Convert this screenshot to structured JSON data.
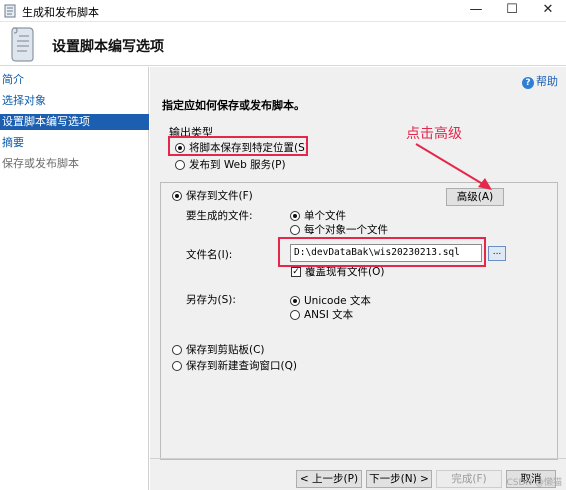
{
  "window": {
    "title": "生成和发布脚本",
    "minimize": "—",
    "maximize": "☐",
    "close": "✕"
  },
  "header": {
    "title": "设置脚本编写选项"
  },
  "sidebar": {
    "items": [
      {
        "label": "简介"
      },
      {
        "label": "选择对象"
      },
      {
        "label": "设置脚本编写选项"
      },
      {
        "label": "摘要"
      },
      {
        "label": "保存或发布脚本"
      }
    ]
  },
  "help": {
    "label": "帮助"
  },
  "main": {
    "instruction": "指定应如何保存或发布脚本。",
    "output_type_label": "输出类型",
    "output_options": [
      {
        "label": "将脚本保存到特定位置(S)",
        "selected": true
      },
      {
        "label": "发布到 Web 服务(P)",
        "selected": false
      }
    ],
    "save_to_file": {
      "label": "保存到文件(F)",
      "selected": true
    },
    "advanced_button": "高级(A)",
    "files_to_generate_label": "要生成的文件:",
    "file_options": [
      {
        "label": "单个文件",
        "selected": true
      },
      {
        "label": "每个对象一个文件",
        "selected": false
      }
    ],
    "filename_label": "文件名(I):",
    "filename_value": "D:\\devDataBak\\wis20230213.sql",
    "browse_label": "...",
    "overwrite": {
      "label": "覆盖现有文件(O)",
      "checked": true
    },
    "save_as_label": "另存为(S):",
    "encoding_options": [
      {
        "label": "Unicode 文本",
        "selected": true
      },
      {
        "label": "ANSI 文本",
        "selected": false
      }
    ],
    "other_destinations": [
      {
        "label": "保存到剪贴板(C)",
        "selected": false
      },
      {
        "label": "保存到新建查询窗口(Q)",
        "selected": false
      }
    ]
  },
  "annotation": {
    "text": "点击高级",
    "color": "#e5274b"
  },
  "footer": {
    "back": "< 上一步(P)",
    "next": "下一步(N) >",
    "finish": "完成(F)",
    "cancel": "取消"
  },
  "colors": {
    "selection": "#1c5fb1",
    "link": "#0d5ba6",
    "highlight": "#e5274b"
  },
  "watermark": "CSDN @懒猫"
}
